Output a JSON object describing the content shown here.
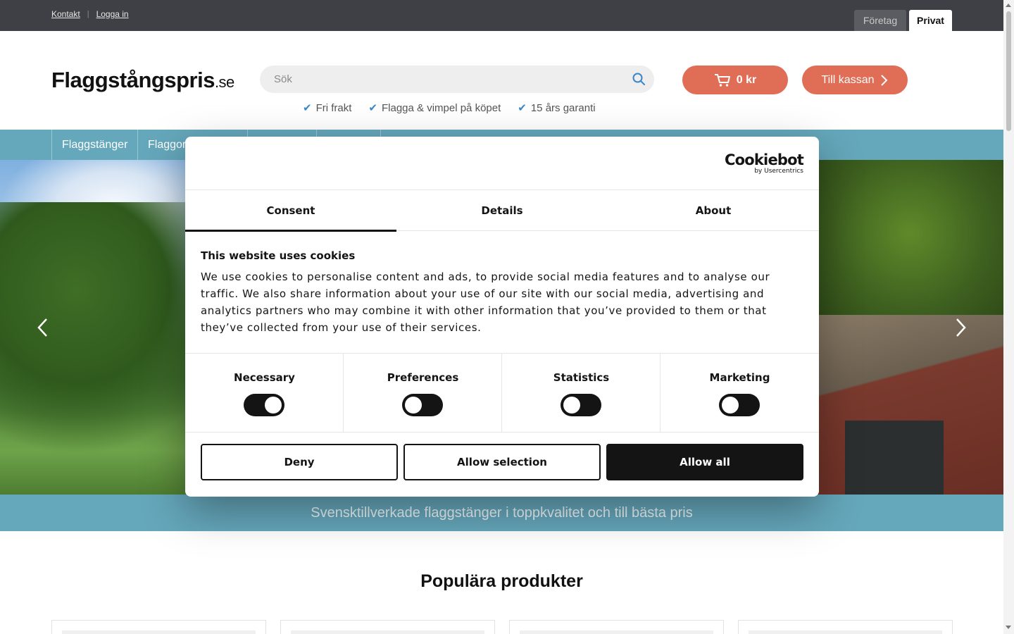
{
  "topbar": {
    "links": [
      "Kontakt",
      "Logga in"
    ],
    "segments": {
      "company": "Företag",
      "private": "Privat"
    }
  },
  "header": {
    "logo_main": "Flaggstångspris",
    "logo_tld": ".se",
    "search_placeholder": "Sök",
    "usps": [
      "Fri frakt",
      "Flagga & vimpel på köpet",
      "15 års garanti"
    ],
    "cart_total": "0 kr",
    "checkout_label": "Till kassan"
  },
  "nav": {
    "items": [
      "Flaggstänger",
      "Flaggor"
    ]
  },
  "hero": {
    "banner": "Svensktillverkade flaggstänger i toppkvalitet och till bästa pris"
  },
  "main": {
    "section_title": "Populära produkter"
  },
  "cookie": {
    "brand": "Cookiebot",
    "brand_sub": "by Usercentrics",
    "tabs": [
      "Consent",
      "Details",
      "About"
    ],
    "active_tab": "Consent",
    "title": "This website uses cookies",
    "text": "We use cookies to personalise content and ads, to provide social media features and to analyse our traffic. We also share information about your use of our site with our social media, advertising and analytics partners who may combine it with other information that you’ve provided to them or that they’ve collected from your use of their services.",
    "categories": [
      {
        "label": "Necessary",
        "state": "on"
      },
      {
        "label": "Preferences",
        "state": "off"
      },
      {
        "label": "Statistics",
        "state": "off"
      },
      {
        "label": "Marketing",
        "state": "off"
      }
    ],
    "buttons": {
      "deny": "Deny",
      "allow_selection": "Allow selection",
      "allow_all": "Allow all"
    }
  },
  "colors": {
    "accent_nav": "#65a7bb",
    "accent_button": "#e06d55",
    "topbar": "#3f4045"
  }
}
